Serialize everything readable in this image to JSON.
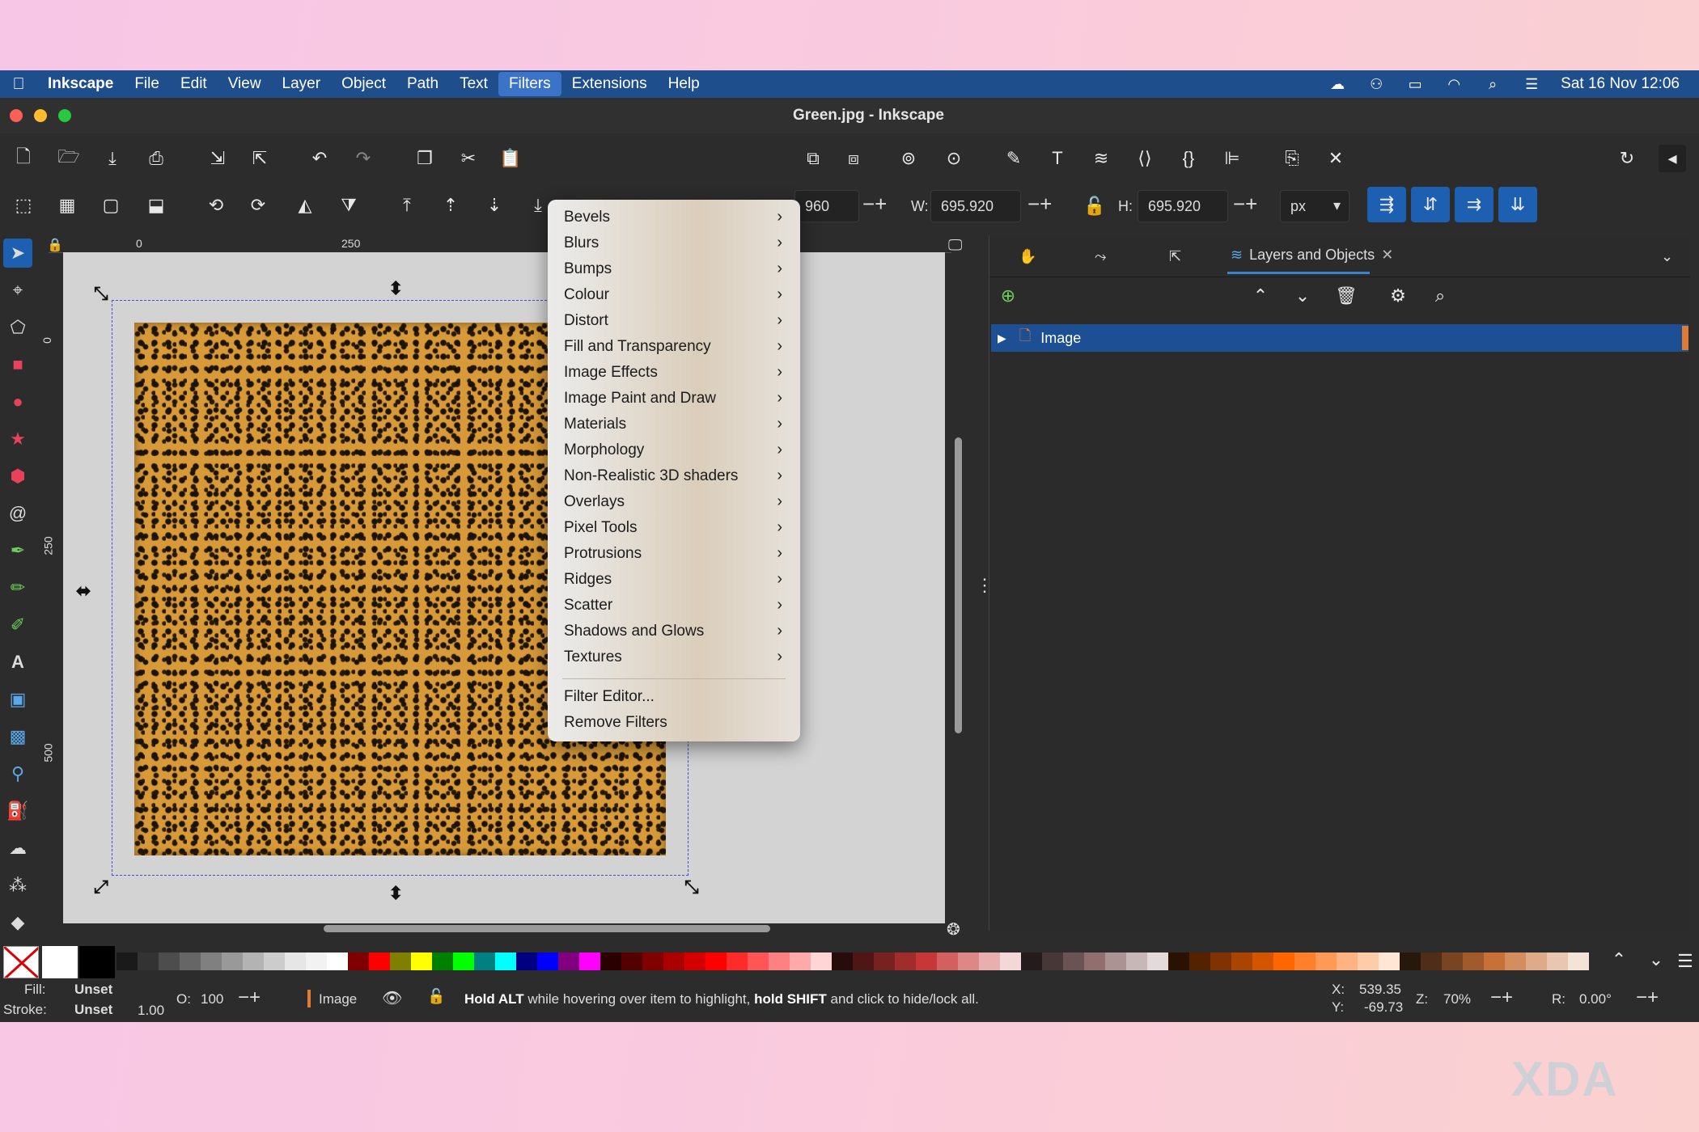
{
  "menubar": {
    "apple": "",
    "app_name": "Inkscape",
    "items": [
      "File",
      "Edit",
      "View",
      "Layer",
      "Object",
      "Path",
      "Text",
      "Filters",
      "Extensions",
      "Help"
    ],
    "active_item": "Filters",
    "clock": "Sat 16 Nov  12:06"
  },
  "window": {
    "title": "Green.jpg - Inkscape"
  },
  "controls": {
    "x_value": "960",
    "w_label": "W:",
    "w_value": "695.920",
    "h_label": "H:",
    "h_value": "695.920",
    "unit": "px"
  },
  "rulers": {
    "h_labels": [
      "0",
      "250"
    ],
    "v_labels": [
      "0",
      "250",
      "500"
    ]
  },
  "filters_menu": {
    "items": [
      "Bevels",
      "Blurs",
      "Bumps",
      "Colour",
      "Distort",
      "Fill and Transparency",
      "Image Effects",
      "Image Paint and Draw",
      "Materials",
      "Morphology",
      "Non-Realistic 3D shaders",
      "Overlays",
      "Pixel Tools",
      "Protrusions",
      "Ridges",
      "Scatter",
      "Shadows and Glows",
      "Textures"
    ],
    "footer_items": [
      "Filter Editor...",
      "Remove Filters"
    ]
  },
  "dock": {
    "active_tab": "Layers and Objects",
    "close_glyph": "✕",
    "layer_name": "Image"
  },
  "status": {
    "fill_label": "Fill:",
    "fill_value": "Unset",
    "stroke_label": "Stroke:",
    "stroke_value": "Unset",
    "stroke_width": "1.00",
    "opacity_label": "O:",
    "opacity_value": "100",
    "layer": "Image",
    "message_bold1": "Hold ALT",
    "message_mid": " while hovering over item to highlight, ",
    "message_bold2": "hold SHIFT",
    "message_end": " and click to hide/lock all.",
    "x_label": "X:",
    "x_value": "539.35",
    "y_label": "Y:",
    "y_value": "-69.73",
    "zoom_label": "Z:",
    "zoom_value": "70%",
    "rotation_label": "R:",
    "rotation_value": "0.00°"
  },
  "palette_colors": [
    "#ffffff",
    "#000000",
    "#1a1a1a",
    "#333333",
    "#4d4d4d",
    "#666666",
    "#808080",
    "#999999",
    "#b3b3b3",
    "#cccccc",
    "#e6e6e6",
    "#f2f2f2",
    "#ffffff",
    "#800000",
    "#ff0000",
    "#808000",
    "#ffff00",
    "#008000",
    "#00ff00",
    "#008080",
    "#00ffff",
    "#000080",
    "#0000ff",
    "#800080",
    "#ff00ff",
    "#2b0000",
    "#550000",
    "#800000",
    "#aa0000",
    "#d40000",
    "#ff0000",
    "#ff2a2a",
    "#ff5555",
    "#ff8080",
    "#ffaaaa",
    "#ffd5d5",
    "#280b0b",
    "#501616",
    "#782121",
    "#a02c2c",
    "#c83737",
    "#d35f5f",
    "#de8787",
    "#e9afaf",
    "#f4d7d7",
    "#241c1c",
    "#483737",
    "#6c5353",
    "#916f6f",
    "#ac9393",
    "#c8b7b7",
    "#e3dbdb",
    "#2b1100",
    "#552200",
    "#803300",
    "#aa4400",
    "#d45500",
    "#ff6600",
    "#ff7f2a",
    "#ff9955",
    "#ffb380",
    "#ffccaa",
    "#ffe6d5",
    "#28170b",
    "#502d16",
    "#784421",
    "#a05a2c",
    "#c87137",
    "#d38d5f",
    "#deaa87",
    "#e9c6af",
    "#f4e3d7",
    "#241f1c",
    "#483e37"
  ],
  "watermark": "XDA"
}
